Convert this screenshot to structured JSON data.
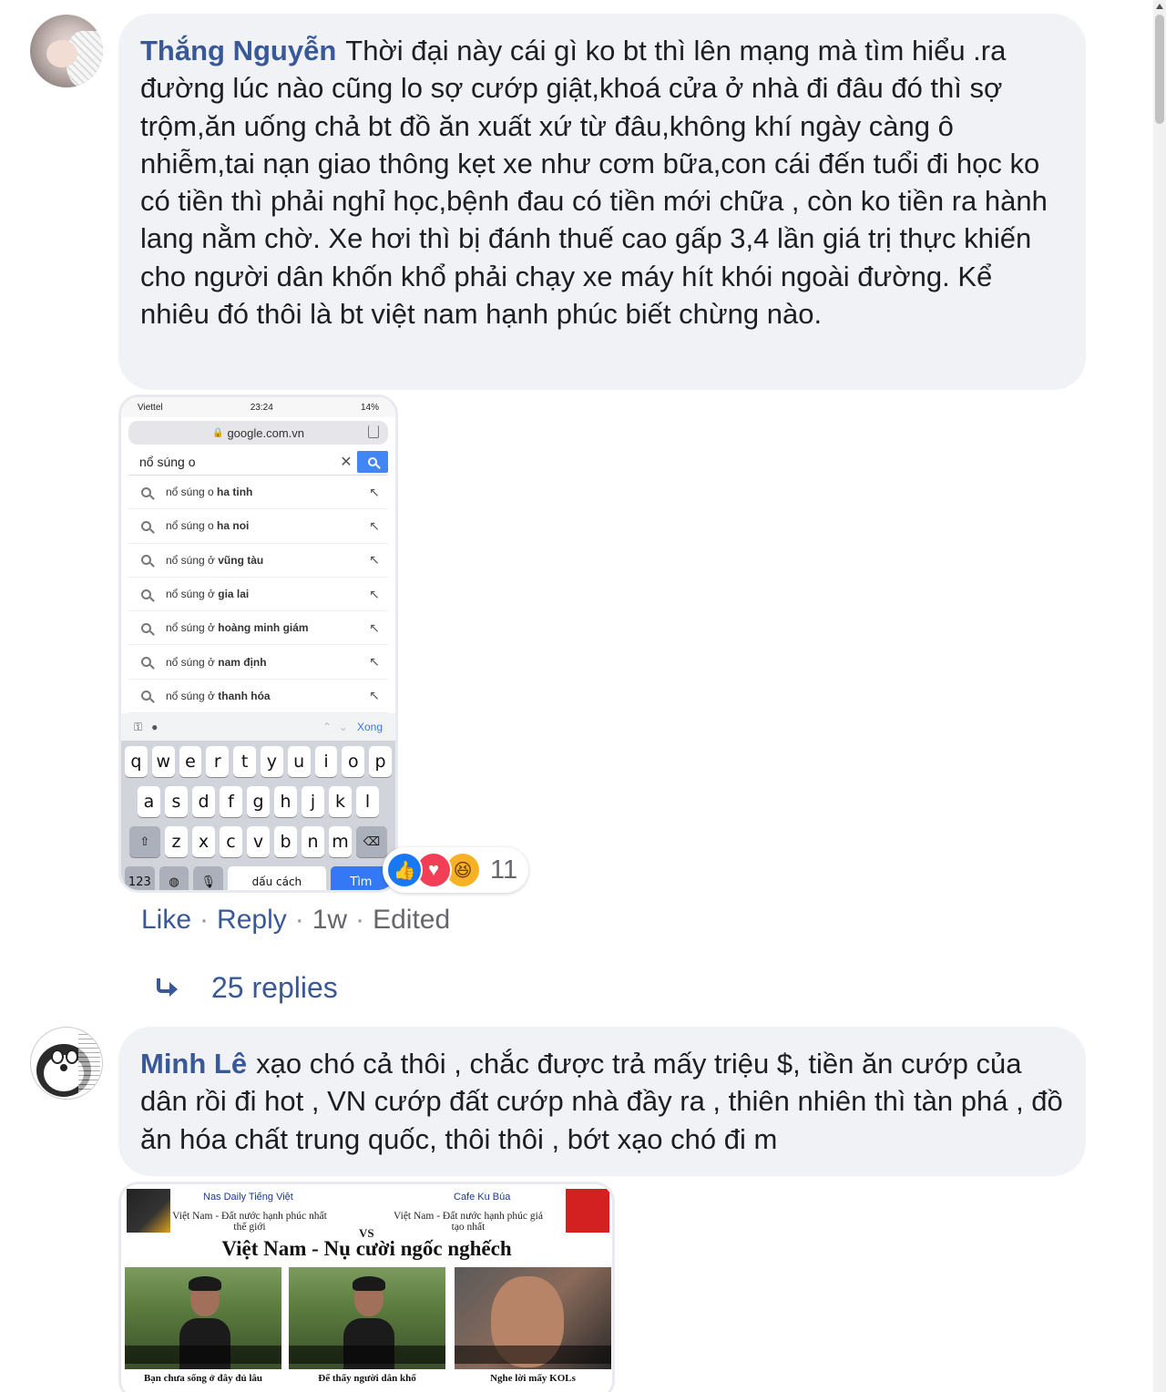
{
  "comment1": {
    "author": "Thắng Nguyễn",
    "text": "Thời đại này cái gì ko bt thì lên mạng mà tìm hiểu .ra đường lúc nào cũng lo sợ cướp giật,khoá cửa ở nhà đi đâu đó thì sợ trộm,ăn uống chả bt đồ ăn xuất xứ từ đâu,không khí ngày càng ô nhiễm,tai nạn giao thông kẹt xe như cơm bữa,con cái đến tuổi đi học ko có tiền thì phải nghỉ học,bệnh đau có tiền mới chữa , còn ko tiền ra hành lang nằm chờ. Xe hơi thì bị đánh thuế cao gấp 3,4 lần giá trị thực khiến cho người dân khốn khổ phải chạy xe máy hít khói ngoài đường. Kể nhiêu đó thôi là bt việt nam hạnh phúc biết chừng nào.",
    "screenshot": {
      "carrier": "Viettel",
      "time": "23:24",
      "battery": "14%",
      "url": "google.com.vn",
      "query": "nổ súng o",
      "suggestions": [
        {
          "prefix": "nổ súng o ",
          "bold": "ha tinh"
        },
        {
          "prefix": "nổ súng o ",
          "bold": "ha noi"
        },
        {
          "prefix": "nổ súng ở ",
          "bold": "vũng tàu"
        },
        {
          "prefix": "nổ súng ở ",
          "bold": "gia lai"
        },
        {
          "prefix": "nổ súng ở ",
          "bold": "hoàng minh giám"
        },
        {
          "prefix": "nổ súng ở ",
          "bold": "nam định"
        },
        {
          "prefix": "nổ súng ở ",
          "bold": "thanh hóa"
        }
      ],
      "toolbar_done": "Xong",
      "keyboard": {
        "row1": [
          "q",
          "w",
          "e",
          "r",
          "t",
          "y",
          "u",
          "i",
          "o",
          "p"
        ],
        "row2": [
          "a",
          "s",
          "d",
          "f",
          "g",
          "h",
          "j",
          "k",
          "l"
        ],
        "row3": [
          "z",
          "x",
          "c",
          "v",
          "b",
          "n",
          "m"
        ],
        "numbers": "123",
        "space": "dấu cách",
        "go": "Tìm"
      }
    },
    "reactions": {
      "icons": [
        "like-icon",
        "love-icon",
        "haha-icon"
      ],
      "count": "11"
    },
    "actions": {
      "like": "Like",
      "reply": "Reply",
      "time": "1w",
      "edited": "Edited"
    },
    "replies_label": "25 replies"
  },
  "comment2": {
    "author": "Minh Lê",
    "text": "xạo chó cả thôi , chắc được trả mấy triệu $, tiền ăn cướp của dân rồi đi hot , VN cướp đất cướp nhà đầy ra , thiên nhiên thì tàn phá , đồ ăn hóa chất trung quốc, thôi thôi , bớt xạo chó đi m",
    "meme": {
      "left_channel": "Nas Daily Tiếng Việt",
      "left_title": "Việt Nam - Đất nước hạnh phúc nhất thế giới",
      "right_channel": "Cafe Ku Búa",
      "right_title": "Việt Nam - Đất nước hạnh phúc giả tạo nhất",
      "vs": "VS",
      "headline": "Việt Nam - Nụ cười ngốc nghếch",
      "captions": [
        "Bạn chưa sống ở đây đủ lâu",
        "Để thấy người dân khổ",
        "Nghe lời mấy KOLs"
      ]
    }
  }
}
